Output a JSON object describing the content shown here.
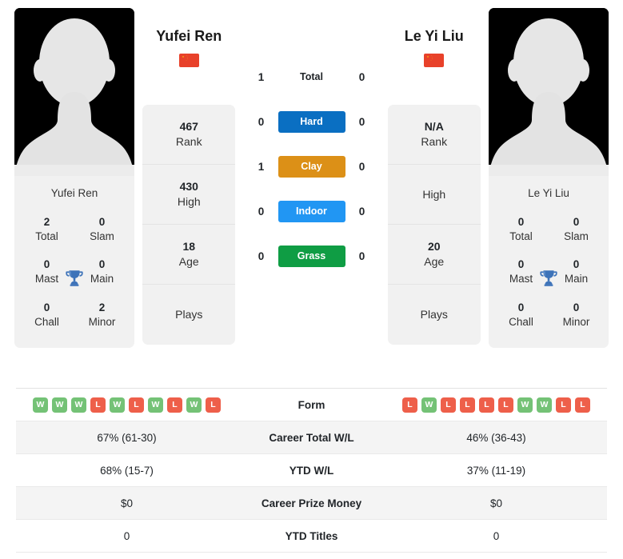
{
  "players": {
    "left": {
      "name": "Yufei Ren",
      "photo_caption": "Yufei Ren",
      "flag": "cn-flag-icon",
      "titles": [
        {
          "value": "2",
          "label": "Total"
        },
        {
          "value": "0",
          "label": "Slam"
        },
        {
          "value": "0",
          "label": "Mast"
        },
        {
          "value": "0",
          "label": "Main"
        },
        {
          "value": "0",
          "label": "Chall"
        },
        {
          "value": "2",
          "label": "Minor"
        }
      ],
      "stats": [
        {
          "value": "467",
          "label": "Rank"
        },
        {
          "value": "430",
          "label": "High"
        },
        {
          "value": "18",
          "label": "Age"
        },
        {
          "value": "",
          "label": "Plays"
        }
      ]
    },
    "right": {
      "name": "Le Yi Liu",
      "photo_caption": "Le Yi Liu",
      "flag": "cn-flag-icon",
      "titles": [
        {
          "value": "0",
          "label": "Total"
        },
        {
          "value": "0",
          "label": "Slam"
        },
        {
          "value": "0",
          "label": "Mast"
        },
        {
          "value": "0",
          "label": "Main"
        },
        {
          "value": "0",
          "label": "Chall"
        },
        {
          "value": "0",
          "label": "Minor"
        }
      ],
      "stats": [
        {
          "value": "N/A",
          "label": "Rank"
        },
        {
          "value": "",
          "label": "High"
        },
        {
          "value": "20",
          "label": "Age"
        },
        {
          "value": "",
          "label": "Plays"
        }
      ]
    }
  },
  "head_to_head": [
    {
      "label": "Total",
      "left": "1",
      "right": "0",
      "badge": false,
      "color": ""
    },
    {
      "label": "Hard",
      "left": "0",
      "right": "0",
      "badge": true,
      "color": "#0a6fc2"
    },
    {
      "label": "Clay",
      "left": "1",
      "right": "0",
      "badge": true,
      "color": "#dc9017"
    },
    {
      "label": "Indoor",
      "left": "0",
      "right": "0",
      "badge": true,
      "color": "#2196f3"
    },
    {
      "label": "Grass",
      "left": "0",
      "right": "0",
      "badge": true,
      "color": "#0f9d44"
    }
  ],
  "table": [
    {
      "label": "Form",
      "type": "form",
      "left_form": [
        "W",
        "W",
        "W",
        "L",
        "W",
        "L",
        "W",
        "L",
        "W",
        "L"
      ],
      "right_form": [
        "L",
        "W",
        "L",
        "L",
        "L",
        "L",
        "W",
        "W",
        "L",
        "L"
      ],
      "alt": false
    },
    {
      "label": "Career Total W/L",
      "type": "text",
      "left": "67% (61-30)",
      "right": "46% (36-43)",
      "alt": true
    },
    {
      "label": "YTD W/L",
      "type": "text",
      "left": "68% (15-7)",
      "right": "37% (11-19)",
      "alt": false
    },
    {
      "label": "Career Prize Money",
      "type": "text",
      "left": "$0",
      "right": "$0",
      "alt": true
    },
    {
      "label": "YTD Titles",
      "type": "text",
      "left": "0",
      "right": "0",
      "alt": false
    }
  ],
  "colors": {
    "win": "#74c276",
    "loss": "#ee5f4a",
    "trophy": "#3d73b9"
  }
}
